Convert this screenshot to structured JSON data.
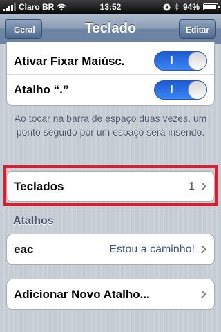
{
  "status_bar": {
    "carrier": "Claro BR",
    "time": "13:52",
    "battery": "94%",
    "battery_level": 0.94
  },
  "nav": {
    "back_label": "Geral",
    "title": "Teclado",
    "edit_label": "Editar"
  },
  "toggles": [
    {
      "label": "Ativar Fixar Maiúsc.",
      "switch_text": "I",
      "on": true
    },
    {
      "label": "Atalho “.”",
      "switch_text": "I",
      "on": true
    }
  ],
  "footnote": "Ao tocar na barra de espaço duas vezes, um ponto seguido por um espaço será inserido.",
  "keyboards": {
    "label": "Teclados",
    "value": "1"
  },
  "shortcuts": {
    "header": "Atalhos",
    "items": [
      {
        "label": "eac",
        "value": "Estou a caminho!"
      }
    ],
    "add_label": "Adicionar Novo Atalho..."
  },
  "colors": {
    "highlight": "#e8172c",
    "switch_on": "#2a6fe0",
    "value_text": "#385487"
  }
}
